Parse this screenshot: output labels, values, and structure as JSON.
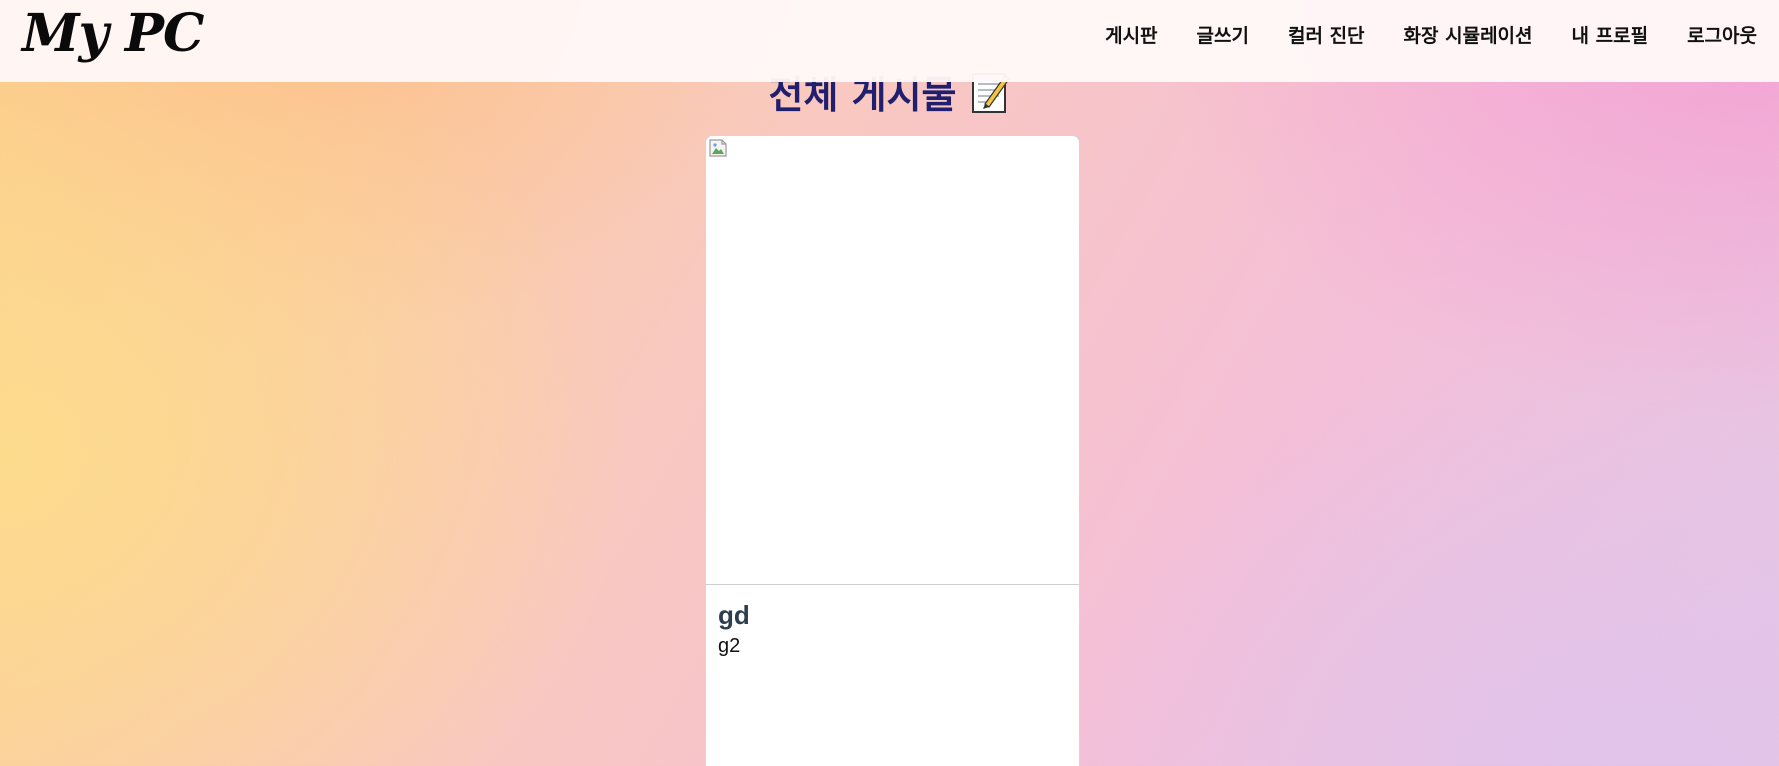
{
  "header": {
    "logo": "My PC",
    "nav": [
      {
        "label": "게시판"
      },
      {
        "label": "글쓰기"
      },
      {
        "label": "컬러 진단"
      },
      {
        "label": "화장 시뮬레이션"
      },
      {
        "label": "내 프로필"
      },
      {
        "label": "로그아웃"
      }
    ]
  },
  "main": {
    "title": "전체 게시물",
    "title_icon": "memo-icon"
  },
  "posts": [
    {
      "title": "gd",
      "content": "g2",
      "image_state": "broken-image-icon"
    }
  ],
  "colors": {
    "header_bg": "#fff8f8",
    "title_color": "#1f1f6e",
    "card_title_color": "#2c3e50"
  }
}
